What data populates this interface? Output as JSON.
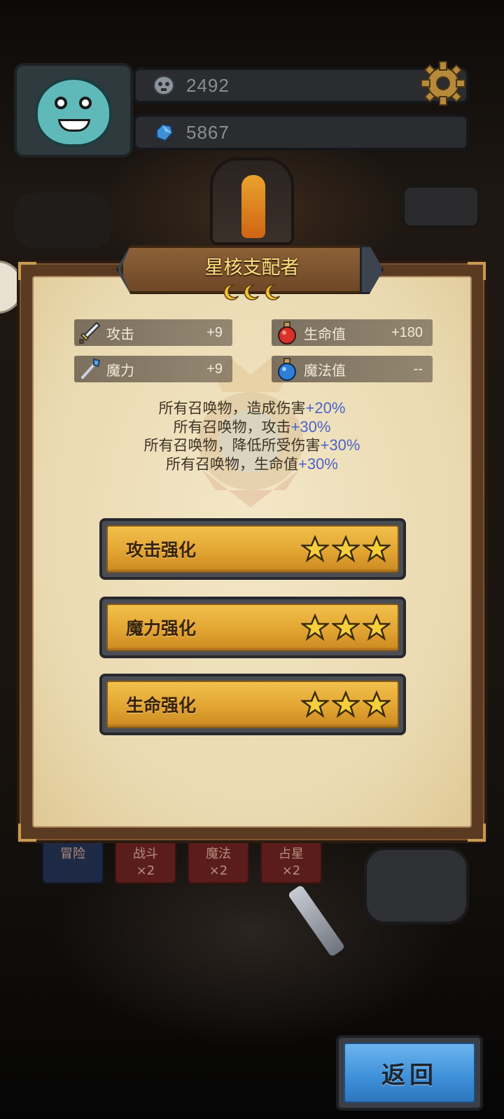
{
  "hud": {
    "coins": "2492",
    "gems": "5867"
  },
  "panel": {
    "title": "星核支配者",
    "stats": {
      "attack_label": "攻击",
      "attack_value": "+9",
      "magic_label": "魔力",
      "magic_value": "+9",
      "hp_label": "生命值",
      "hp_value": "+180",
      "mp_label": "魔法值",
      "mp_value": "--"
    },
    "effects": [
      {
        "text": "所有召唤物，造成伤害",
        "value": "+20%"
      },
      {
        "text": "所有召唤物，攻击",
        "value": "+30%"
      },
      {
        "text": "所有召唤物，降低所受伤害",
        "value": "+30%"
      },
      {
        "text": "所有召唤物，生命值",
        "value": "+30%"
      }
    ],
    "upgrades": [
      {
        "label": "攻击强化",
        "stars": 3
      },
      {
        "label": "魔力强化",
        "stars": 3
      },
      {
        "label": "生命强化",
        "stars": 3
      }
    ]
  },
  "background_tabs": [
    "冒险",
    "战斗\n×2",
    "魔法\n×2",
    "占星\n×2"
  ],
  "back_button": "返回",
  "colors": {
    "title_gold": "#fbe07c",
    "effect_value_blue": "#4b63c8",
    "upgrade_gold": "#e2a532",
    "back_blue": "#3d8fd8"
  },
  "icons": {
    "coin": "skull-coin-icon",
    "gem": "blue-gem-icon",
    "settings": "gear-icon",
    "attack": "sword-icon",
    "magic": "staff-icon",
    "hp": "red-potion-icon",
    "mp": "blue-potion-icon",
    "rank": "crescent-moon-icon",
    "star": "gold-star-icon"
  }
}
